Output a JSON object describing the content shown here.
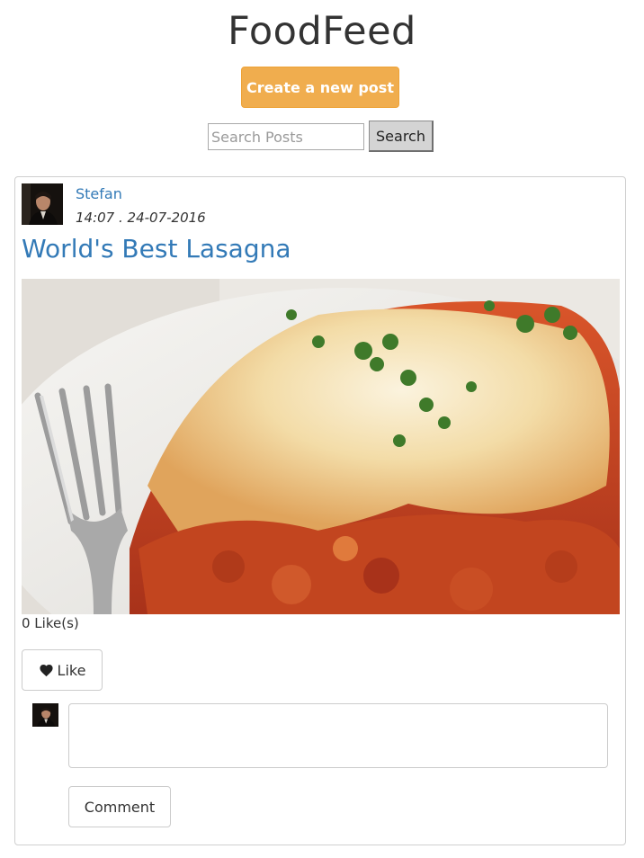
{
  "header": {
    "app_title": "FoodFeed",
    "create_button_label": "Create a new post"
  },
  "search": {
    "placeholder": "Search Posts",
    "value": "",
    "button_label": "Search"
  },
  "colors": {
    "accent": "#f0ad4e",
    "link": "#337ab7",
    "text": "#333333"
  },
  "post": {
    "author": "Stefan",
    "timestamp": "14:07 . 24-07-2016",
    "title": "World's Best Lasagna",
    "likes_text": "0 Like(s)",
    "like_button_label": "Like",
    "like_icon": "heart-icon",
    "comment_value": "",
    "comment_button_label": "Comment"
  }
}
